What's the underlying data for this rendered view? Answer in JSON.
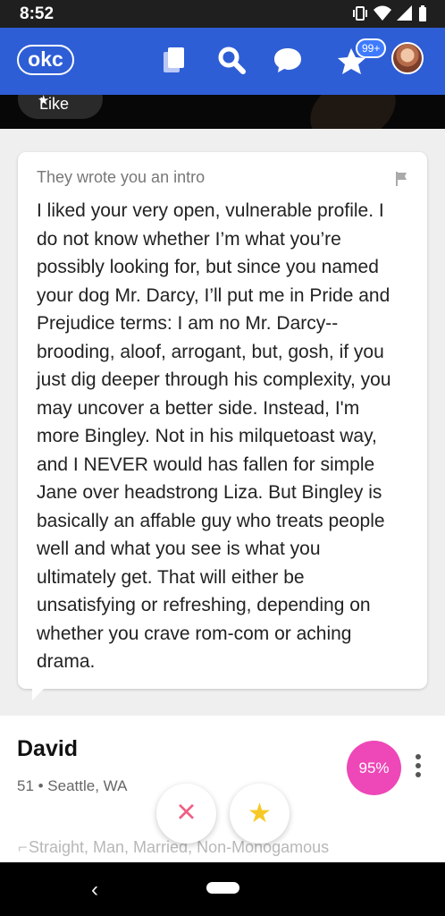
{
  "status_bar": {
    "time": "8:52"
  },
  "app_bar": {
    "logo": "okc",
    "notifications_badge": "99+"
  },
  "photo": {
    "like_label": "Like"
  },
  "intro": {
    "heading": "They wrote you an intro",
    "body": [
      "I liked your very open, vulnerable profile. I",
      "do not know whether I’m what you’re",
      "possibly looking for, but since you named",
      "your dog Mr. Darcy, I’ll put me in Pride and",
      "Prejudice terms: I am no Mr. Darcy--",
      "brooding, aloof, arrogant, but, gosh, if you",
      "just dig deeper through his complexity, you",
      "may uncover a better side. Instead, I'm",
      "more Bingley. Not in his milquetoast way,",
      "and I NEVER would has fallen for simple",
      "Jane over headstrong Liza. But Bingley is",
      "basically an affable guy who treats people",
      "well and what you see is what you",
      "ultimately get. That will either be",
      "unsatisfying or refreshing, depending on",
      "whether you crave rom-com or aching",
      "drama."
    ]
  },
  "profile": {
    "name": "David",
    "details": "51 • Seattle, WA",
    "match": "95%",
    "partially_visible": "Straight, Man, Married, Non-Monogamous"
  },
  "icons": {
    "status": [
      "vibrate-icon",
      "wifi-icon",
      "signal-icon",
      "battery-icon"
    ],
    "nav": [
      "cards-icon",
      "search-icon",
      "messages-icon",
      "star-icon"
    ],
    "actions": [
      "dislike-icon",
      "star-icon"
    ],
    "system": [
      "back-icon",
      "home-icon"
    ]
  },
  "colors": {
    "brand": "#2e5ed6",
    "badge": "#3f7bff",
    "match": "#ee47b7",
    "dislike": "#f05f84",
    "favorite": "#f6c926"
  }
}
